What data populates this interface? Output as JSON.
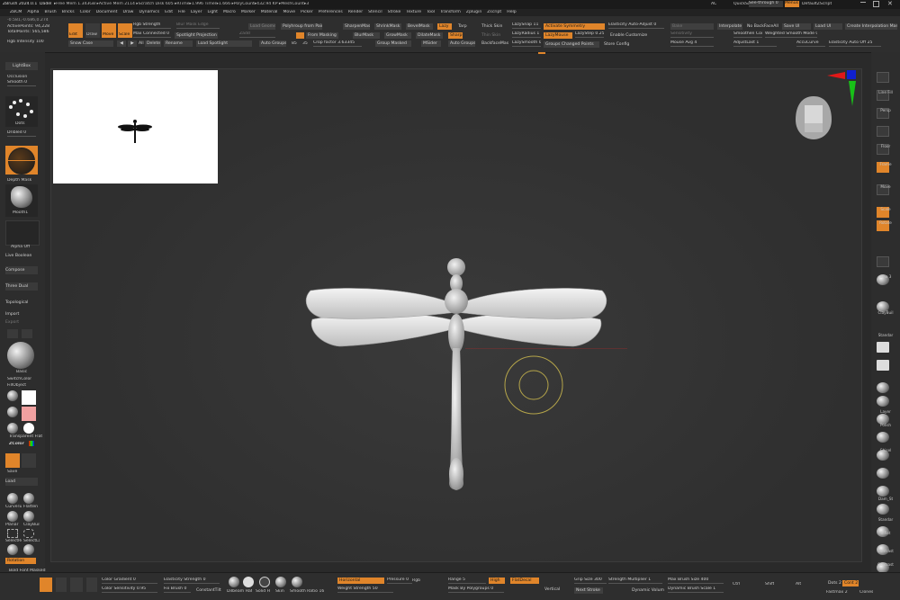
{
  "title_bar": {
    "app": "ZBrush 2024.0.1",
    "doc": "Dadel",
    "stats": "▸Free Mem 1.343GB ▸Active Mem 2114 ▸Scratch Disk 605 ▸RTime▸1.996 Timer▸1.666 ▸PolyCount▸432.94 KP ▸MeshCount▸3",
    "right_items": [
      "AC",
      "QuickSave",
      "See-through 0",
      "Menus",
      "DefaultZScript"
    ]
  },
  "menu_bar": [
    "ZBCM",
    "Alpha",
    "Brush",
    "Bricks",
    "Color",
    "Document",
    "Draw",
    "Dynamics",
    "Edit",
    "File",
    "Layer",
    "Light",
    "Macro",
    "Marker",
    "Material",
    "Movie",
    "Picker",
    "Preferences",
    "Render",
    "Stencil",
    "Stroke",
    "Texture",
    "Tool",
    "Transform",
    "Zplugin",
    "Zscript",
    "Help"
  ],
  "top_shelf": {
    "info": [
      "ActivePoints: 94,228",
      "TotalPoints: 565,586",
      "Rgb Intensity 100"
    ],
    "coords": "-0.581,-0.686,0.274",
    "mode_buttons": [
      "Edit",
      "Draw",
      "Move",
      "Scale",
      "Rotate"
    ],
    "row1": [
      "Rgb Strength",
      "Blur Mask Edge",
      "Load Geometry",
      "Polyhroup from Paint",
      "SharpenMask",
      "ShrinkMask",
      "BevelMask",
      "Lazy",
      "Tarp",
      "Thick Skin",
      "LazySnap 11",
      "Activate Symmetry",
      "Elasticity Auto-Adjust 0",
      "Bake",
      "Interpolate",
      "No BackFaceAll",
      "Save UI",
      "Load UI",
      "Create Interpolation Mask"
    ],
    "row2": [
      "Max Connected 0",
      "Spotlight Projection",
      "Zadd",
      "From Masking",
      "BlurMask",
      "GrowMask",
      "DilateMask",
      "SharpEdge",
      "Thin Skin",
      "LazyRadius 1",
      "LazyMouse",
      "LazyStep 0.25",
      "Enable Customize",
      "Sensitivity",
      "Smoothen Count",
      "Weighted Smooth Mode 0"
    ],
    "row3": [
      "Snow Case",
      "All",
      "Delete",
      "Rename",
      "Load Spotlight",
      "Auto Groups",
      "85",
      "35",
      "Crop factor 3.63345",
      "Group Masked",
      "MSider",
      "Auto Groups",
      "BackfaceMask",
      "LazySmooth 0",
      "Groups Changed Points",
      "Store Config",
      "Mouse Avg 4",
      "AdjustLast 1",
      "AccuCurve",
      "Elasticity Auto Off 25"
    ]
  },
  "left_panel": {
    "lightbox": "LightBox",
    "occlusion": "Occlusion",
    "smooth": "Smooth 0",
    "dots_label": "Dots",
    "dribble": "Dribled 0",
    "depth_mask": "Depth Mask",
    "alpha_label": "Mooth1",
    "alpha_off": "Alpha Off",
    "buttons": [
      "Live Boolean",
      "Compose",
      "Three Dual",
      "Topological",
      "Import",
      "Export"
    ],
    "material": "Basic",
    "switch_color": "SwitchColor",
    "fill_object": "FillObject",
    "gradient": "Gradient",
    "zcolor": "ZColor",
    "texture_label": "Transparent Flat",
    "save": "Save",
    "load": "Load",
    "brushes": [
      "CurveTub",
      "Flatten",
      "Planar",
      "ClayBuil",
      "SelectRe",
      "SelectLa"
    ],
    "rotation": "Rotation",
    "bottom": "Bold Font Masked"
  },
  "right_panel": {
    "labels": [
      "Line Fill",
      "Persp",
      "Floor",
      "Frame",
      "Move",
      "Scale",
      "Rotate",
      "SPix 3",
      "ClayBuil",
      "Standar",
      "Layer",
      "Polish",
      "Chisel",
      "Dam_St",
      "Standar",
      "Inflat",
      "Contrast",
      "Contrast"
    ]
  },
  "canvas": {
    "minimap_present": true,
    "cursor_present": true
  },
  "bottom_bar": {
    "items": [
      "Color Gradient 0",
      "Color Sensitivity 0.95",
      "Elasticity Strength 0",
      "Fix Brush 0",
      "ConstantTilt",
      "Dilbeam Hatch",
      "Solid H",
      "Skin",
      "Smooth Ratio 16",
      "Horizontal",
      "Weight Strength 50",
      "Pressure 0",
      "Rgb",
      "Range 5",
      "Mask By Polygroups 0",
      "High",
      "FlatDecal",
      "Vertical",
      "Grip Size 300",
      "Strength Multiplier 1",
      "Next Stroke",
      "Dynamic Volume",
      "Max Brush Size 400",
      "Dynamic Brush Scale 1",
      "Ctrl",
      "Shift",
      "Alt",
      "Dots 2",
      "Cont 2",
      "Fastmax 2",
      "Clones"
    ]
  }
}
